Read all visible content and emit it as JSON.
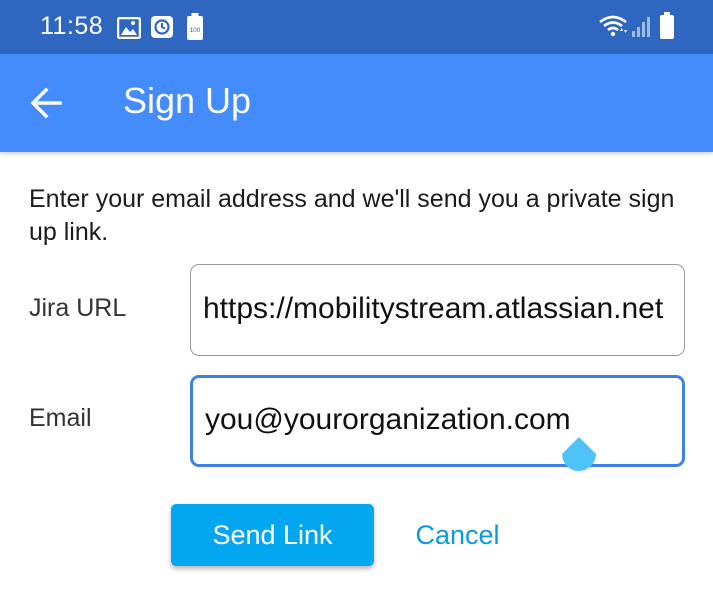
{
  "status_bar": {
    "time": "11:58",
    "battery_icon_text": "100",
    "icons": [
      "image-icon",
      "clock-icon",
      "battery-saver-icon",
      "wifi-icon",
      "signal-icon",
      "battery-icon"
    ]
  },
  "app_bar": {
    "title": "Sign Up",
    "back_icon": "arrow-left-icon"
  },
  "content": {
    "intro": "Enter your email address and we'll send you a private sign up link.",
    "jira_url": {
      "label": "Jira URL",
      "value": "https://mobilitystream.atlassian.net"
    },
    "email": {
      "label": "Email",
      "value": "you@yourorganization.com"
    }
  },
  "actions": {
    "send_label": "Send Link",
    "cancel_label": "Cancel"
  },
  "colors": {
    "status_bar": "#2f66bf",
    "app_bar": "#448cfb",
    "focused_border": "#3d80e6",
    "primary_button": "#03a7ef",
    "cancel_text": "#0a9ae0",
    "text_handle": "#4fc3f7"
  }
}
